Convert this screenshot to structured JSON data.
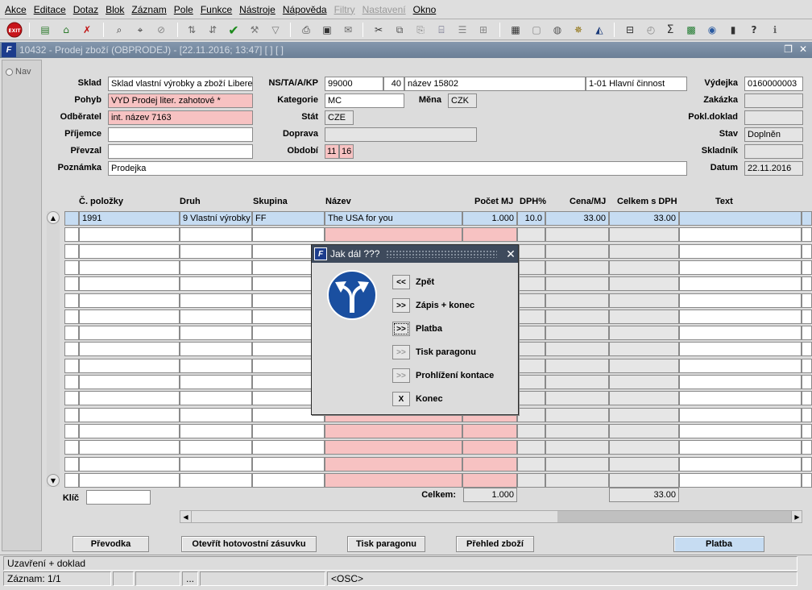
{
  "menu": [
    "Akce",
    "Editace",
    "Dotaz",
    "Blok",
    "Záznam",
    "Pole",
    "Funkce",
    "Nástroje",
    "Nápověda",
    "Filtry",
    "Nastavení",
    "Okno"
  ],
  "menu_disabled": [
    "Filtry",
    "Nastavení"
  ],
  "toolbar": {
    "exit_label": "EXIT"
  },
  "window": {
    "title": "10432 - Prodej zboží (OBPRODEJ) - [22.11.2016; 13:47]  [ ]  [ ]",
    "logo": "F"
  },
  "nav": {
    "label": "Nav"
  },
  "form": {
    "sklad_label": "Sklad",
    "sklad_value": "Sklad vlastní výrobky a zboží Liberec",
    "pohyb_label": "Pohyb",
    "pohyb_value": "VYD Prodej liter. zahotové *",
    "odberatel_label": "Odběratel",
    "odberatel_value": "int. název 7163",
    "prijemce_label": "Příjemce",
    "prijemce_value": "",
    "prevzal_label": "Převzal",
    "prevzal_value": "",
    "poznamka_label": "Poznámka",
    "poznamka_value": "Prodejka",
    "ns_label": "NS/TA/A/KP",
    "ns_value": "99000",
    "ta_value": "40",
    "a_value": "název 15802",
    "kp_value": "1-01 Hlavní činnost",
    "kategorie_label": "Kategorie",
    "kategorie_value": "MC",
    "mena_label": "Měna",
    "mena_value": "CZK",
    "stat_label": "Stát",
    "stat_value": "CZE",
    "doprava_label": "Doprava",
    "doprava_value": "",
    "obdobi_label": "Období",
    "obdobi_month": "11",
    "obdobi_year": "16",
    "vydejka_label": "Výdejka",
    "vydejka_value": "0160000003",
    "zakazka_label": "Zakázka",
    "zakazka_value": "",
    "pokl_label": "Pokl.doklad",
    "pokl_value": "",
    "stav_label": "Stav",
    "stav_value": "Doplněn",
    "skladnik_label": "Skladník",
    "skladnik_value": "",
    "datum_label": "Datum",
    "datum_value": "22.11.2016"
  },
  "table": {
    "headers": [
      "Č. položky",
      "Druh",
      "Skupina",
      "Název",
      "Počet MJ",
      "DPH%",
      "Cena/MJ",
      "Celkem s DPH",
      "Text"
    ],
    "rows": [
      {
        "cislo": "1991",
        "druh": "9 Vlastní výrobky",
        "skupina": "FF",
        "nazev": "The USA for you",
        "pocet": "1.000",
        "dph": "10.0",
        "cena": "33.00",
        "celkem": "33.00",
        "text": ""
      }
    ],
    "klic_label": "Klíč",
    "klic_value": "",
    "celkem_label": "Celkem:",
    "celkem_pocet": "1.000",
    "celkem_castka": "33.00"
  },
  "buttons": {
    "prevodka": "Převodka",
    "zasuvka": "Otevřít hotovostní zásuvku",
    "tisk": "Tisk paragonu",
    "prehled": "Přehled zboží",
    "platba": "Platba"
  },
  "dialog": {
    "title": "Jak dál ???",
    "close": "✕",
    "options": [
      {
        "btn": "<<",
        "label": "Zpět",
        "enabled": true
      },
      {
        "btn": ">>",
        "label": "Zápis + konec",
        "enabled": true
      },
      {
        "btn": ">>",
        "label": "Platba",
        "enabled": true,
        "focused": true
      },
      {
        "btn": ">>",
        "label": "Tisk paragonu",
        "enabled": false
      },
      {
        "btn": ">>",
        "label": "Prohlížení kontace",
        "enabled": false
      },
      {
        "btn": "X",
        "label": "Konec",
        "enabled": true
      }
    ]
  },
  "status": {
    "message": "Uzavření + doklad",
    "record": "Záznam: 1/1",
    "ellipsis": "...",
    "mode": "<OSC>"
  },
  "colors": {
    "pink": "#f7c2c2",
    "selected": "#c6dcf2",
    "title_bar": "#6b7f96",
    "dialog_title": "#3e4a5c",
    "sign_blue": "#1a4fa0"
  }
}
